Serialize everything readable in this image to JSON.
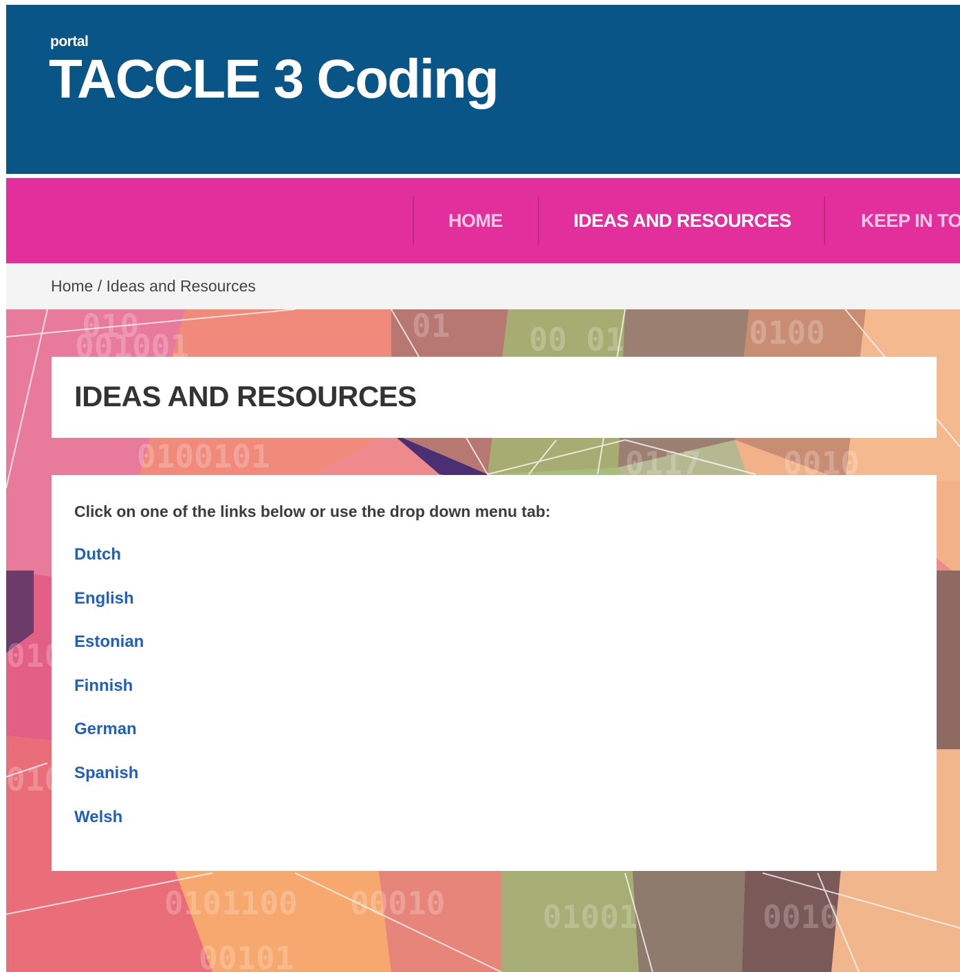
{
  "header": {
    "kicker": "portal",
    "title": "TACCLE 3 Coding"
  },
  "nav": {
    "items": [
      {
        "label": "HOME"
      },
      {
        "label": "IDEAS AND RESOURCES"
      },
      {
        "label": "KEEP IN TO"
      }
    ]
  },
  "breadcrumb": {
    "home": "Home",
    "separator": " / ",
    "current": "Ideas and Resources"
  },
  "page": {
    "heading": "IDEAS AND RESOURCES",
    "intro": "Click on one of the links below or use the drop down menu tab:",
    "languages": [
      "Dutch",
      "English",
      "Estonian",
      "Finnish",
      "German",
      "Spanish",
      "Welsh"
    ]
  },
  "colors": {
    "header_bg": "#095587",
    "nav_bg": "#e32f9c",
    "link": "#1f5fbf"
  }
}
